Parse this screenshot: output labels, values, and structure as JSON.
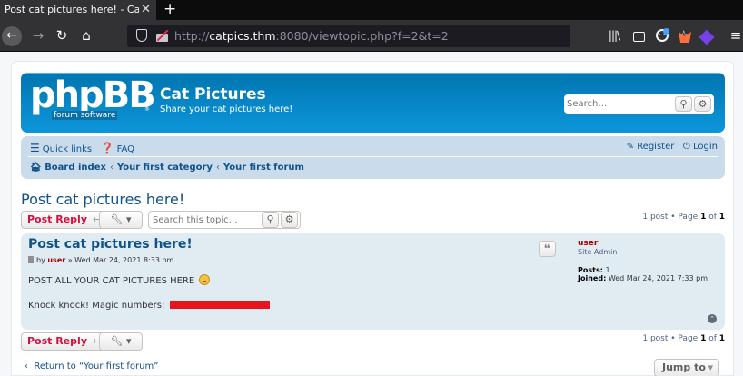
{
  "browser": {
    "tab_title": "Post cat pictures here! - Cat Pictures",
    "tab_close": "✕",
    "new_tab": "+",
    "url_scheme": "http://",
    "url_host": "catpics.thm",
    "url_rest": ":8080/viewtopic.php?f=2&t=2",
    "more": "···"
  },
  "site": {
    "logo_text": "phpBB",
    "logo_sub": "forum software",
    "logo_mark": "®",
    "title": "Cat Pictures",
    "description": "Share your cat pictures here!",
    "search_placeholder": "Search…"
  },
  "nav": {
    "quick_links": "Quick links",
    "faq": "FAQ",
    "register": "Register",
    "login": "Login",
    "breadcrumbs": [
      "Board index",
      "Your first category",
      "Your first forum"
    ]
  },
  "topic": {
    "title": "Post cat pictures here!",
    "post_reply": "Post Reply",
    "search_placeholder": "Search this topic…",
    "pagination_prefix": "1 post • Page ",
    "page_current": "1",
    "page_of": " of ",
    "page_total": "1"
  },
  "post": {
    "title": "Post cat pictures here!",
    "by": "by ",
    "author": "user",
    "date": " » Wed Mar 24, 2021 8:33 pm",
    "line1": "POST ALL YOUR CAT PICTURES HERE",
    "line2": "Knock knock! Magic numbers: ",
    "quote_glyph": "❝",
    "profile": {
      "username": "user",
      "rank": "Site Admin",
      "posts_label": "Posts:",
      "posts_value": "1",
      "joined_label": "Joined:",
      "joined_value": "Wed Mar 24, 2021 7:33 pm"
    }
  },
  "footer": {
    "return_text": "Return to “Your first forum”",
    "jump_to": "Jump to"
  },
  "colors": {
    "header_blue": "#12a3eb",
    "nav_bg": "#cadceb",
    "post_bg": "#e1ebf2",
    "link": "#105289",
    "button_red": "#d31141",
    "redaction": "#e8141d"
  }
}
